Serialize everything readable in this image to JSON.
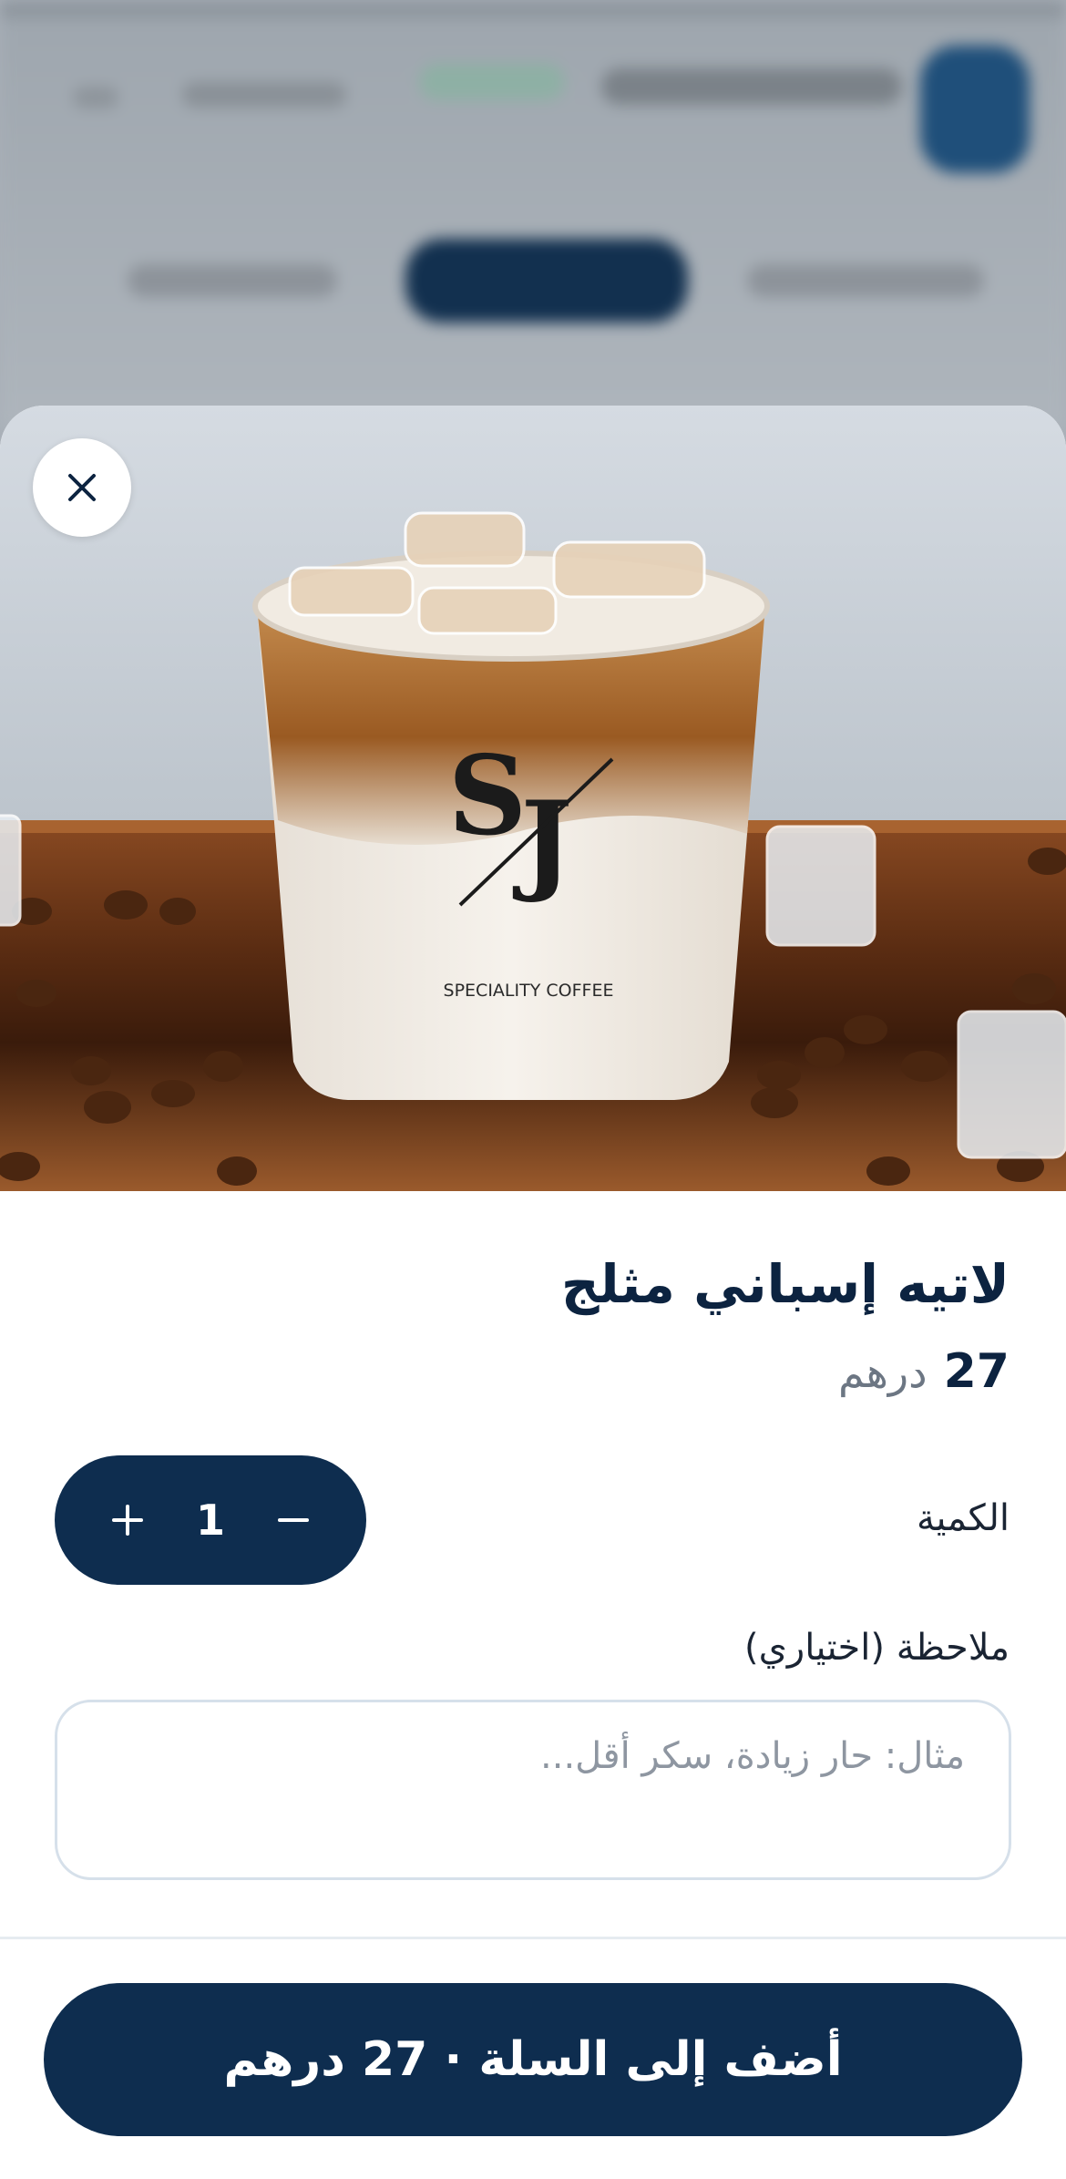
{
  "product": {
    "name": "لاتيه إسباني مثلج",
    "price_value": "27",
    "price_currency": "درهم",
    "cup_brand": "SPECIALITY COFFEE",
    "cup_logo": "SJ"
  },
  "quantity": {
    "label": "الكمية",
    "value": "1",
    "increment_symbol": "+",
    "decrement_symbol": "−"
  },
  "note": {
    "label": "ملاحظة (اختياري)",
    "placeholder": "مثال: حار زيادة، سكر أقل..."
  },
  "cta": {
    "text": "أضف إلى السلة",
    "separator": "·",
    "amount": "27",
    "currency": "درهم"
  },
  "icons": {
    "close": "close-icon",
    "plus": "plus-icon",
    "minus": "minus-icon"
  },
  "colors": {
    "primary": "#0e2d4f",
    "title": "#0c2340",
    "muted": "#6c7683",
    "border": "#d6e0ea"
  }
}
